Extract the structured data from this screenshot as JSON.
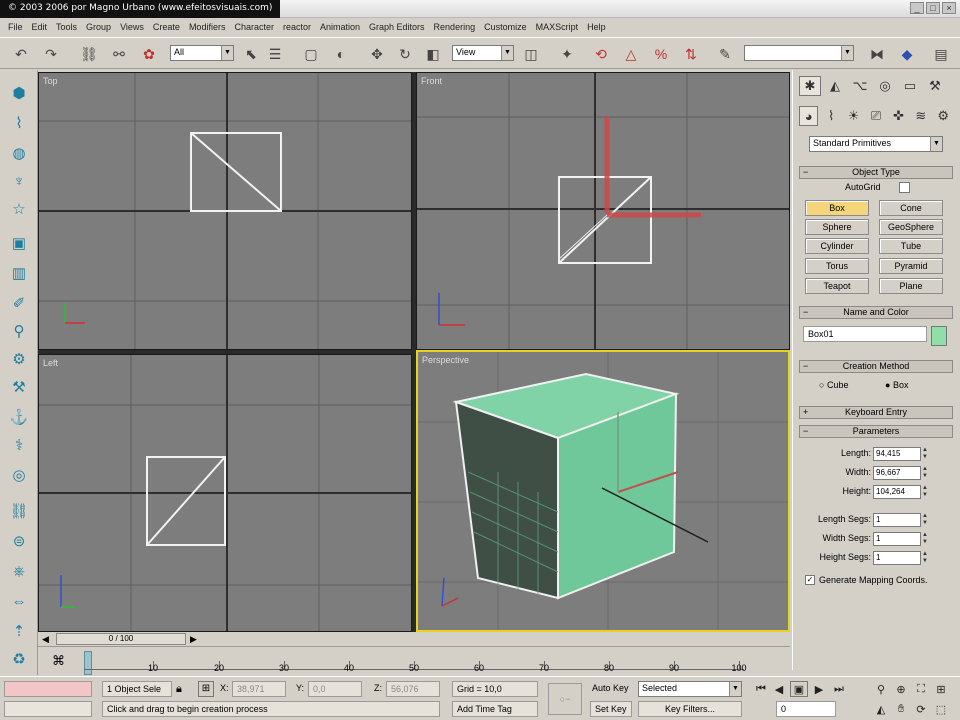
{
  "watermark": "© 2003 2006 por Magno Urbano (www.efeitosvisuais.com)",
  "menu": [
    "File",
    "Edit",
    "Tools",
    "Group",
    "Views",
    "Create",
    "Modifiers",
    "Character",
    "reactor",
    "Animation",
    "Graph Editors",
    "Rendering",
    "Customize",
    "MAXScript",
    "Help"
  ],
  "toolbar": {
    "selection_filter": "All",
    "ref_coord": "View",
    "named_sel": ""
  },
  "viewports": {
    "top": "Top",
    "front": "Front",
    "left": "Left",
    "perspective": "Perspective"
  },
  "command_panel": {
    "category": "Standard Primitives",
    "object_type": {
      "title": "Object Type",
      "autogrid": "AutoGrid",
      "buttons": [
        "Box",
        "Cone",
        "Sphere",
        "GeoSphere",
        "Cylinder",
        "Tube",
        "Torus",
        "Pyramid",
        "Teapot",
        "Plane"
      ]
    },
    "name_color": {
      "title": "Name and Color",
      "name": "Box01",
      "color": "#8ee0a8"
    },
    "creation_method": {
      "title": "Creation Method",
      "opt1": "Cube",
      "opt2": "Box"
    },
    "keyboard_entry": "Keyboard Entry",
    "parameters": {
      "title": "Parameters",
      "length_label": "Length:",
      "length": "94,415",
      "width_label": "Width:",
      "width": "96,667",
      "height_label": "Height:",
      "height": "104,264",
      "lsegs_label": "Length Segs:",
      "lsegs": "1",
      "wsegs_label": "Width Segs:",
      "wsegs": "1",
      "hsegs_label": "Height Segs:",
      "hsegs": "1",
      "gen_mapping": "Generate Mapping Coords."
    }
  },
  "timeline": {
    "slider": "0 / 100",
    "ticks": [
      "10",
      "20",
      "30",
      "40",
      "50",
      "60",
      "70",
      "80",
      "90",
      "100"
    ]
  },
  "status": {
    "selected": "1 Object Sele",
    "x_label": "X:",
    "x": "38,971",
    "y_label": "Y:",
    "y": "0,0",
    "z_label": "Z:",
    "z": "56,076",
    "grid": "Grid = 10,0",
    "prompt": "Click and drag to begin creation process",
    "add_time_tag": "Add Time Tag",
    "autokey": "Auto Key",
    "selected_dd": "Selected",
    "setkey": "Set Key",
    "keyfilters": "Key Filters...",
    "frame": "0"
  },
  "colors": {
    "viewport_bg": "#7d7d7d",
    "box_green": "#6fc89a",
    "active_border": "#e8d220"
  }
}
